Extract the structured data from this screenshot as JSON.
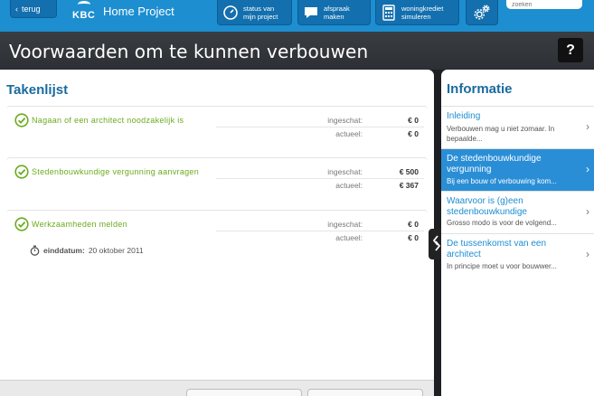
{
  "header": {
    "back_label": "terug",
    "logo_text": "KBC",
    "app_name": "Home Project",
    "tools": [
      {
        "label": "status van\nmijn project",
        "icon": "speedometer-icon"
      },
      {
        "label": "afspraak\nmaken",
        "icon": "chat-bubble-icon"
      },
      {
        "label": "woningkrediet\nsimuleren",
        "icon": "calculator-icon"
      }
    ],
    "settings_icon": "gear-icon",
    "search_placeholder": "zoeken"
  },
  "page": {
    "title": "Voorwaarden om te kunnen verbouwen",
    "help_label": "?"
  },
  "tasks": {
    "title": "Takenlijst",
    "estimate_label": "ingeschat:",
    "actual_label": "actueel:",
    "items": [
      {
        "name": "Nagaan of een architect noodzakelijk is",
        "estimate": "€ 0",
        "actual": "€ 0",
        "done": true
      },
      {
        "name": "Stedenbouwkundige vergunning aanvragen",
        "estimate": "€ 500",
        "actual": "€ 367",
        "done": true
      },
      {
        "name": "Werkzaamheden melden",
        "estimate": "€ 0",
        "actual": "€ 0",
        "done": true,
        "enddate_label": "einddatum:",
        "enddate": "20 oktober 2011"
      }
    ]
  },
  "info": {
    "title": "Informatie",
    "items": [
      {
        "heading": "Inleiding",
        "desc": "Verbouwen mag u niet zomaar. In bepaalde...",
        "active": false
      },
      {
        "heading": "De stedenbouwkundige vergunning",
        "desc": "Bij een bouw of verbouwing kom...",
        "active": true
      },
      {
        "heading": "Waarvoor is (g)een stedenbouwkundige",
        "desc": "Grosso modo is voor de volgend...",
        "active": false
      },
      {
        "heading": "De tussenkomst van een architect",
        "desc": "In principe moet u voor bouwwer...",
        "active": false
      }
    ]
  },
  "colors": {
    "brand_blue": "#1d8ed0",
    "task_green": "#6bab1d",
    "heading_blue": "#1a6a9e",
    "active_item": "#2a8ed6"
  }
}
